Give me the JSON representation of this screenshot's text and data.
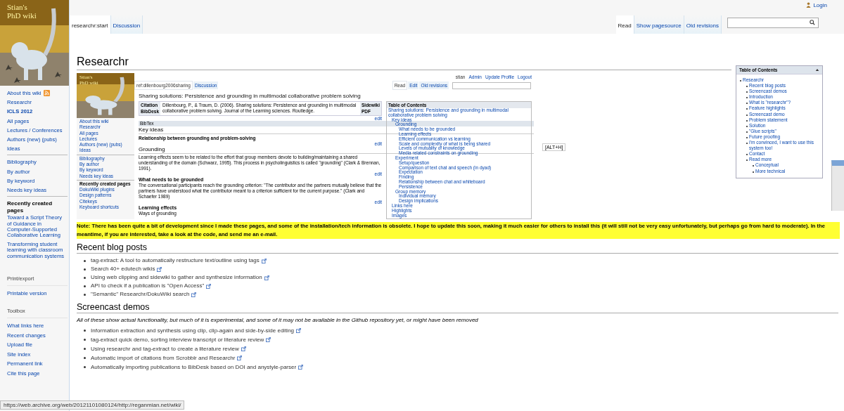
{
  "logo": {
    "lines": [
      "Stian's",
      "PhD wiki"
    ]
  },
  "sidebar": {
    "navigation": [
      [
        {
          "label": "About this wiki",
          "kind": "feed"
        },
        {
          "label": "Researchr",
          "kind": "link"
        },
        {
          "label": "ICLS 2012",
          "kind": "bold"
        },
        {
          "label": "All pages",
          "kind": "link"
        },
        {
          "label": "Lectures / Conferences",
          "kind": "link"
        },
        {
          "label": "Authors (new) (pubs)",
          "kind": "link"
        },
        {
          "label": "Ideas",
          "kind": "link"
        }
      ],
      [
        {
          "label": "Bibliography",
          "kind": "link"
        },
        {
          "label": "By author",
          "kind": "link"
        },
        {
          "label": "By keyword",
          "kind": "link"
        },
        {
          "label": "Needs key ideas",
          "kind": "link"
        }
      ],
      [
        {
          "label": "Recently created pages",
          "kind": "heading"
        },
        {
          "label": "Toward a Script Theory of Guidance in Computer-Supported Collaborative Learning",
          "kind": "link"
        },
        {
          "label": "Transforming student learning with classroom communication systems",
          "kind": "link"
        }
      ]
    ],
    "portlets": [
      {
        "title": "Print/export",
        "items": [
          "Printable version"
        ]
      },
      {
        "title": "Toolbox",
        "items": [
          "What links here",
          "Recent changes",
          "Upload file",
          "Site index",
          "Permanent link",
          "Cite this page"
        ]
      }
    ]
  },
  "header": {
    "login": "Login",
    "page_tabs": [
      {
        "label": "researchr:start",
        "selected": true
      },
      {
        "label": "Discussion",
        "selected": false
      }
    ],
    "views": [
      {
        "label": "Read",
        "selected": true
      },
      {
        "label": "Show pagesource",
        "selected": false
      },
      {
        "label": "Old revisions",
        "selected": false
      }
    ]
  },
  "title": "Researchr",
  "screenshot": {
    "logo_lines": [
      "Stian's",
      "PhD wiki"
    ],
    "user_links": [
      "stian",
      "Admin",
      "Update Profile",
      "Logout"
    ],
    "page_tabs": [
      {
        "label": "ref:dillenbourg2006sharing",
        "selected": true
      },
      {
        "label": "Discussion",
        "selected": false
      }
    ],
    "views": [
      {
        "label": "Read",
        "selected": true
      },
      {
        "label": "Edit",
        "selected": false
      },
      {
        "label": "Old revisions",
        "selected": false
      }
    ],
    "sidebar": [
      [
        {
          "label": "About this wiki",
          "kind": "link"
        },
        {
          "label": "Researchr",
          "kind": "link"
        },
        {
          "label": "All pages",
          "kind": "link"
        },
        {
          "label": "Lectures",
          "kind": "link"
        },
        {
          "label": "Authors (new) (pubs)",
          "kind": "link"
        },
        {
          "label": "Ideas",
          "kind": "link"
        }
      ],
      [
        {
          "label": "Bibliography",
          "kind": "link"
        },
        {
          "label": "By author",
          "kind": "link"
        },
        {
          "label": "By keyword",
          "kind": "link"
        },
        {
          "label": "Needs key ideas",
          "kind": "link"
        }
      ],
      [
        {
          "label": "Recently created pages",
          "kind": "heading"
        },
        {
          "label": "DokuWiki plugins",
          "kind": "link"
        },
        {
          "label": "Design patterns",
          "kind": "link"
        },
        {
          "label": "Citekeys",
          "kind": "link"
        },
        {
          "label": "Keyboard shortcuts",
          "kind": "link"
        }
      ]
    ],
    "title": "Sharing solutions: Persistence and grounding in multimodal collaborative problem solving",
    "citation": {
      "label": "Citation",
      "bibdesk": "BibDesk",
      "text": "Dillenbourg, P., & Traum, D. (2006). Sharing solutions: Persistence and grounding in multimodal collaborative problem solving. Journal of the Learning sciences. Routledge.",
      "sidewiki": "Sidewiki",
      "pdf": "PDF",
      "edit": "edit"
    },
    "bibtex": "BibTex",
    "blocks": [
      {
        "kind": "h2",
        "text": "Key ideas"
      },
      {
        "kind": "bold",
        "text": "Relationship between grounding and problem-solving"
      },
      {
        "kind": "h2",
        "text": "Grounding",
        "edit": "edit"
      },
      {
        "kind": "p",
        "text": "Learning effects seem to be related to the effort that group members devote to building/maintaining a shared understanding of the domain (Schwarz, 1995). This process in psycholinguistics is called \"grounding\" (Clark & Brennan, 1991)."
      },
      {
        "kind": "h3",
        "text": "What needs to be grounded",
        "edit": "edit"
      },
      {
        "kind": "p",
        "text": "The conversational participants reach the grounding criterion: \"The contributor and the partners mutually believe that the partners have understood what the contributor meant to a criterion sufficient for the current purpose.\" (Clark and Schaefer 1989)"
      },
      {
        "kind": "h3",
        "text": "Learning effects",
        "edit": "edit"
      },
      {
        "kind": "p",
        "text": "Ways of grounding"
      }
    ],
    "toc": {
      "title": "Table of Contents",
      "items": [
        {
          "label": "Sharing solutions: Persistence and grounding in multimodal collaborative problem solving",
          "children": [
            {
              "label": "Key ideas",
              "children": [
                {
                  "label": "Grounding",
                  "children": [
                    {
                      "label": "What needs to be grounded"
                    },
                    {
                      "label": "Learning effects"
                    },
                    {
                      "label": "Efficient communication vs learning"
                    },
                    {
                      "label": "Scale and complexity of what is being shared"
                    },
                    {
                      "label": "Levels of mutuality of knowledge"
                    },
                    {
                      "label": "Media related constraints on grounding"
                    }
                  ]
                },
                {
                  "label": "Experiment",
                  "children": [
                    {
                      "label": "Setup/question"
                    },
                    {
                      "label": "Comparison of text chat and speech (in dyad)"
                    },
                    {
                      "label": "Expectation"
                    },
                    {
                      "label": "Finding"
                    },
                    {
                      "label": "Relationship between chat and whiteboard"
                    },
                    {
                      "label": "Persistence"
                    }
                  ]
                },
                {
                  "label": "Group memory",
                  "children": [
                    {
                      "label": "Individual memory"
                    },
                    {
                      "label": "Design implications"
                    }
                  ]
                }
              ]
            },
            {
              "label": "Links here"
            },
            {
              "label": "Highlights"
            },
            {
              "label": "Images"
            }
          ]
        }
      ]
    }
  },
  "tooltip": "[ALT+H]",
  "toc": {
    "title": "Table of Contents",
    "expanded": true,
    "items": [
      {
        "label": "Researchr",
        "children": [
          {
            "label": "Recent blog posts"
          },
          {
            "label": "Screencast demos"
          },
          {
            "label": "Introduction"
          },
          {
            "label": "What is \"researchr\"?"
          },
          {
            "label": "Feature highlights"
          },
          {
            "label": "Screencast demo"
          },
          {
            "label": "Problem statement"
          },
          {
            "label": "Solution"
          },
          {
            "label": "\"Glue scripts\""
          },
          {
            "label": "Future proofing"
          },
          {
            "label": "I'm convinced, I want to use this system too!"
          },
          {
            "label": "Contact"
          },
          {
            "label": "Read more",
            "children": [
              {
                "label": "Conceptual"
              },
              {
                "label": "More technical"
              }
            ]
          }
        ]
      }
    ]
  },
  "note": "Note: There has been quite a bit of development since I made these pages, and some of the installation/tech information is obsolete. I hope to update this soon, making it much easier for others to install this (it will still not be very easy unfortunately, but perhaps go from hard to moderate). In the meantime, if you are interested, take a look at the code, and send me an e-mail.",
  "sections": [
    {
      "heading": "Recent blog posts",
      "links": [
        "tag-extract: A tool to automatically restructure text/outline using tags",
        "Search 40+ edutech wikis",
        "Using web clipping and sidewiki to gather and synthesize information",
        "API to check if a publication is \"Open Access\"",
        "\"Semantic\" Researchr/DokuWiki search"
      ]
    },
    {
      "heading": "Screencast demos",
      "intro": "All of these show actual functionality, but much of it is experimental, and some of it may not be available in the Github repository yet, or might have been removed",
      "links": [
        "Information extraction and synthesis using clip, clip-again and side-by-side editing",
        "tag-extract quick demo, sorting interview transcript or literature review",
        "Using researchr and tag-extract to create a literature review",
        "Automatic import of citations from Scrobblr and Researchr",
        "Automatically importing publications to BibDesk based on DOI and anystyle-parser"
      ]
    }
  ],
  "status_url": "https://web.archive.org/web/20121101080124/http://reganmian.net/wiki/"
}
